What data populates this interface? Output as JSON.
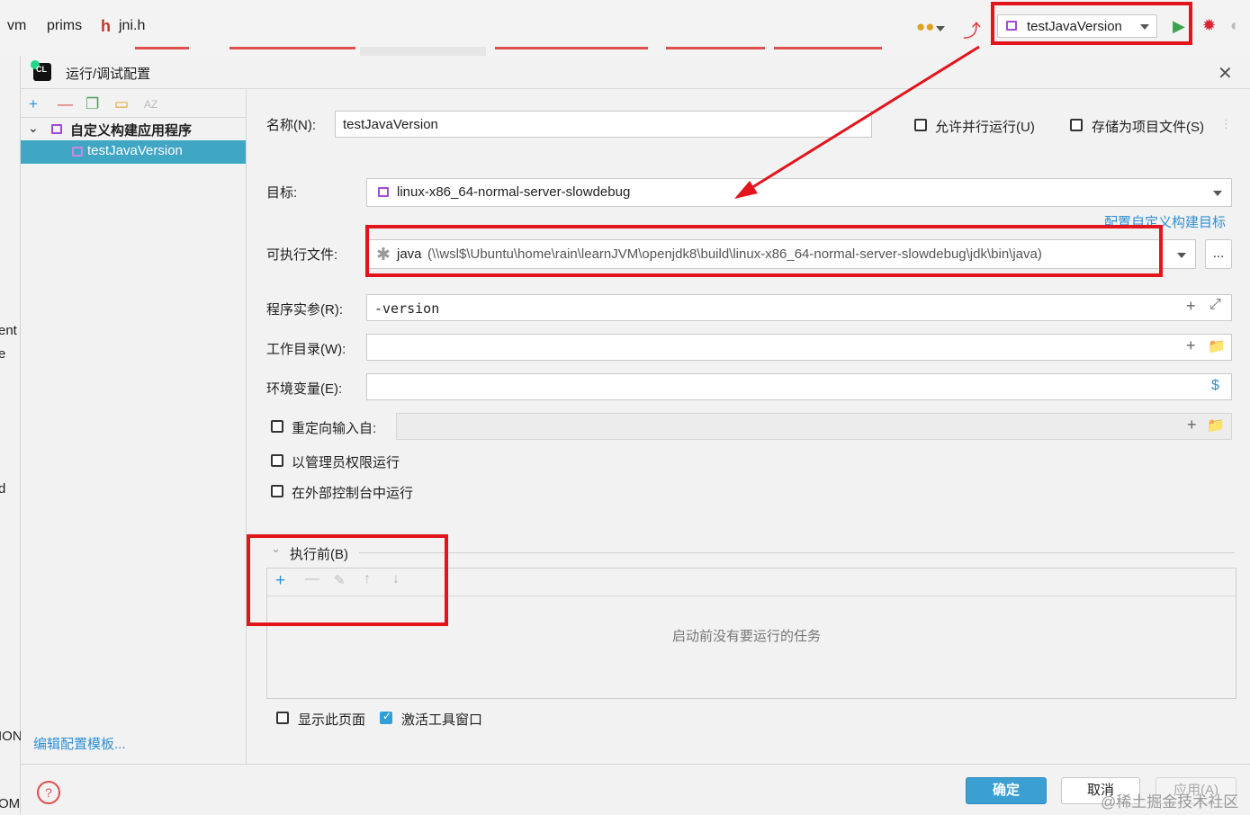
{
  "ide": {
    "breadcrumbs": [
      "vm",
      "prims",
      "jni.h"
    ],
    "run_config": "testJavaVersion"
  },
  "dialog": {
    "title": "运行/调试配置",
    "tree": {
      "group_label": "自定义构建应用程序",
      "selected_item": "testJavaVersion"
    },
    "edit_templates_link": "编辑配置模板...",
    "name_label": "名称(N):",
    "name_value": "testJavaVersion",
    "allow_parallel_label": "允许并行运行(U)",
    "store_as_file_label": "存储为项目文件(S)",
    "target_label": "目标:",
    "target_value": "linux-x86_64-normal-server-slowdebug",
    "configure_target_link": "配置自定义构建目标",
    "executable_label": "可执行文件:",
    "executable_name": "java",
    "executable_path": "(\\\\wsl$\\Ubuntu\\home\\rain\\learnJVM\\openjdk8\\build\\linux-x86_64-normal-server-slowdebug\\jdk\\bin\\java)",
    "browse_button": "...",
    "program_args_label": "程序实参(R):",
    "program_args_value": "-version",
    "working_dir_label": "工作目录(W):",
    "env_vars_label": "环境变量(E):",
    "redirect_input_label": "重定向输入自:",
    "run_as_admin_label": "以管理员权限运行",
    "run_external_console_label": "在外部控制台中运行",
    "before_launch_label": "执行前(B)",
    "before_launch_empty": "启动前没有要运行的任务",
    "show_page_label": "显示此页面",
    "activate_tool_window_label": "激活工具窗口",
    "ok_button": "确定",
    "cancel_button": "取消",
    "apply_button": "应用(A)",
    "watermark": "@稀土掘金技术社区"
  },
  "left_edge_fragments": [
    "ent",
    "e",
    "d",
    "ION",
    "OME"
  ],
  "colors": {
    "accent": "#3fa6c3",
    "highlight_box": "#e2141c",
    "link": "#2e8fd6",
    "ok_button": "#3b9fd1"
  }
}
